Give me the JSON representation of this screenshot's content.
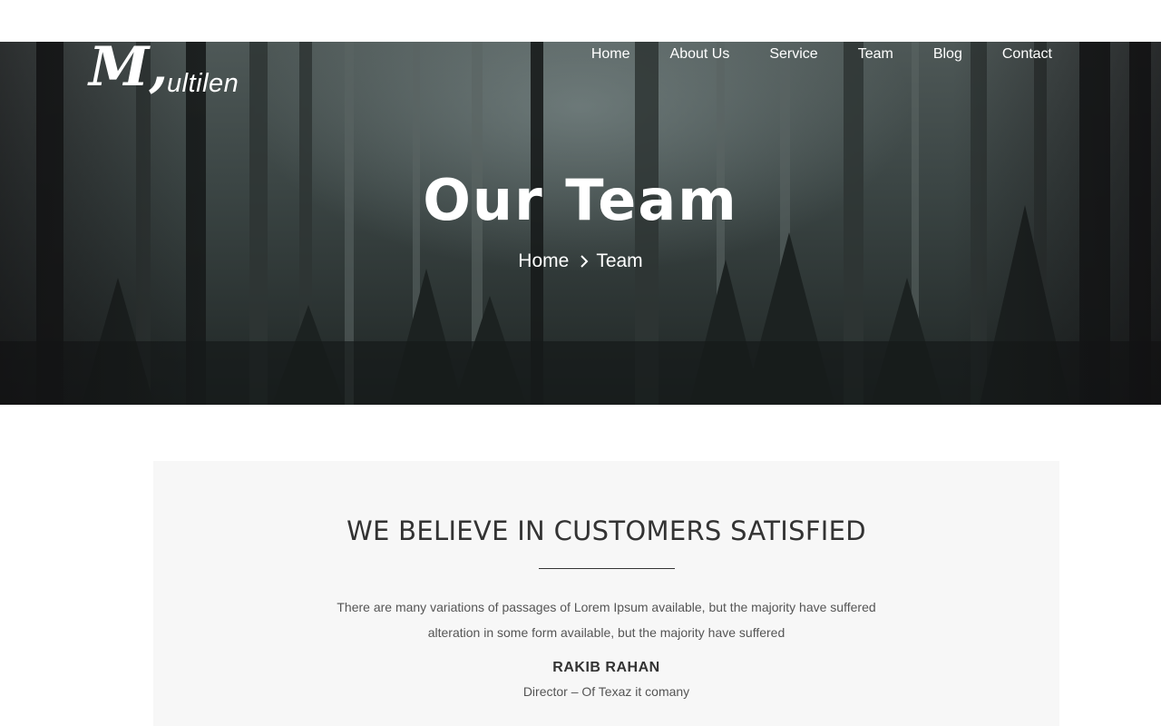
{
  "brand": {
    "logo_initial": "M,",
    "logo_rest": "ultilen"
  },
  "nav": {
    "items": [
      {
        "label": "Home"
      },
      {
        "label": "About Us"
      },
      {
        "label": "Service"
      },
      {
        "label": "Team"
      },
      {
        "label": "Blog"
      },
      {
        "label": "Contact"
      }
    ]
  },
  "hero": {
    "title": "Our Team",
    "breadcrumb": {
      "home": "Home",
      "current": "Team"
    }
  },
  "testimonial": {
    "heading": "WE BELIEVE IN CUSTOMERS SATISFIED",
    "text": "There are many variations of passages of Lorem Ipsum available, but the majority have suffered alteration in some form available, but the majority have suffered",
    "name": "RAKIB RAHAN",
    "role": "Director – Of Texaz it comany"
  },
  "colors": {
    "panel_bg": "#f7f7f7",
    "heading": "#333333",
    "body_text": "#555555",
    "hero_text": "#ffffff"
  }
}
